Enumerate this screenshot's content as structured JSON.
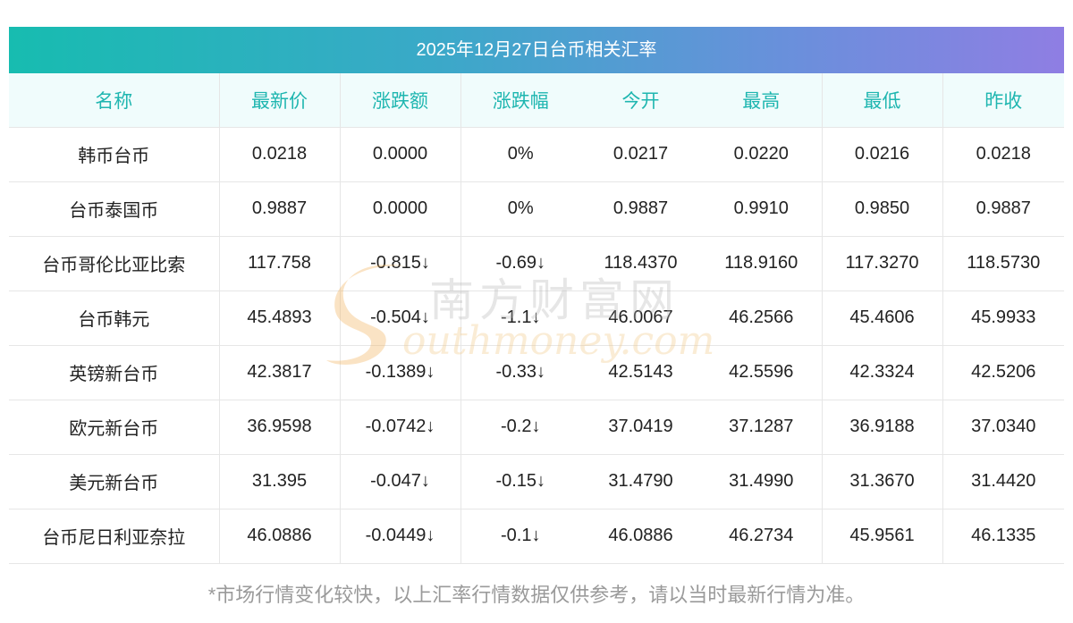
{
  "title": "2025年12月27日台币相关汇率",
  "headers": [
    "名称",
    "最新价",
    "涨跌额",
    "涨跌幅",
    "今开",
    "最高",
    "最低",
    "昨收"
  ],
  "rows": [
    {
      "name": "韩币台币",
      "latest": "0.0218",
      "change": "0.0000",
      "change_pct": "0%",
      "open": "0.0217",
      "high": "0.0220",
      "low": "0.0216",
      "prev_close": "0.0218",
      "trend": "flat"
    },
    {
      "name": "台币泰国币",
      "latest": "0.9887",
      "change": "0.0000",
      "change_pct": "0%",
      "open": "0.9887",
      "high": "0.9910",
      "low": "0.9850",
      "prev_close": "0.9887",
      "trend": "flat"
    },
    {
      "name": "台币哥伦比亚比索",
      "latest": "117.758",
      "change": "-0.815↓",
      "change_pct": "-0.69↓",
      "open": "118.4370",
      "high": "118.9160",
      "low": "117.3270",
      "prev_close": "118.5730",
      "trend": "down"
    },
    {
      "name": "台币韩元",
      "latest": "45.4893",
      "change": "-0.504↓",
      "change_pct": "-1.1↓",
      "open": "46.0067",
      "high": "46.2566",
      "low": "45.4606",
      "prev_close": "45.9933",
      "trend": "down"
    },
    {
      "name": "英镑新台币",
      "latest": "42.3817",
      "change": "-0.1389↓",
      "change_pct": "-0.33↓",
      "open": "42.5143",
      "high": "42.5596",
      "low": "42.3324",
      "prev_close": "42.5206",
      "trend": "down"
    },
    {
      "name": "欧元新台币",
      "latest": "36.9598",
      "change": "-0.0742↓",
      "change_pct": "-0.2↓",
      "open": "37.0419",
      "high": "37.1287",
      "low": "36.9188",
      "prev_close": "37.0340",
      "trend": "down"
    },
    {
      "name": "美元新台币",
      "latest": "31.395",
      "change": "-0.047↓",
      "change_pct": "-0.15↓",
      "open": "31.4790",
      "high": "31.4990",
      "low": "31.3670",
      "prev_close": "31.4420",
      "trend": "down"
    },
    {
      "name": "台币尼日利亚奈拉",
      "latest": "46.0886",
      "change": "-0.0449↓",
      "change_pct": "-0.1↓",
      "open": "46.0886",
      "high": "46.2734",
      "low": "45.9561",
      "prev_close": "46.1335",
      "trend": "down"
    }
  ],
  "footnote": "*市场行情变化较快，以上汇率行情数据仅供参考，请以当时最新行情为准。",
  "watermark": {
    "cn": "南方财富网",
    "en": "outhmoney.com"
  },
  "colors": {
    "header_text": "#1fb6b0",
    "down": "#1a8a1a",
    "title_gradient_start": "#17bcb0",
    "title_gradient_end": "#8f7ee3"
  }
}
